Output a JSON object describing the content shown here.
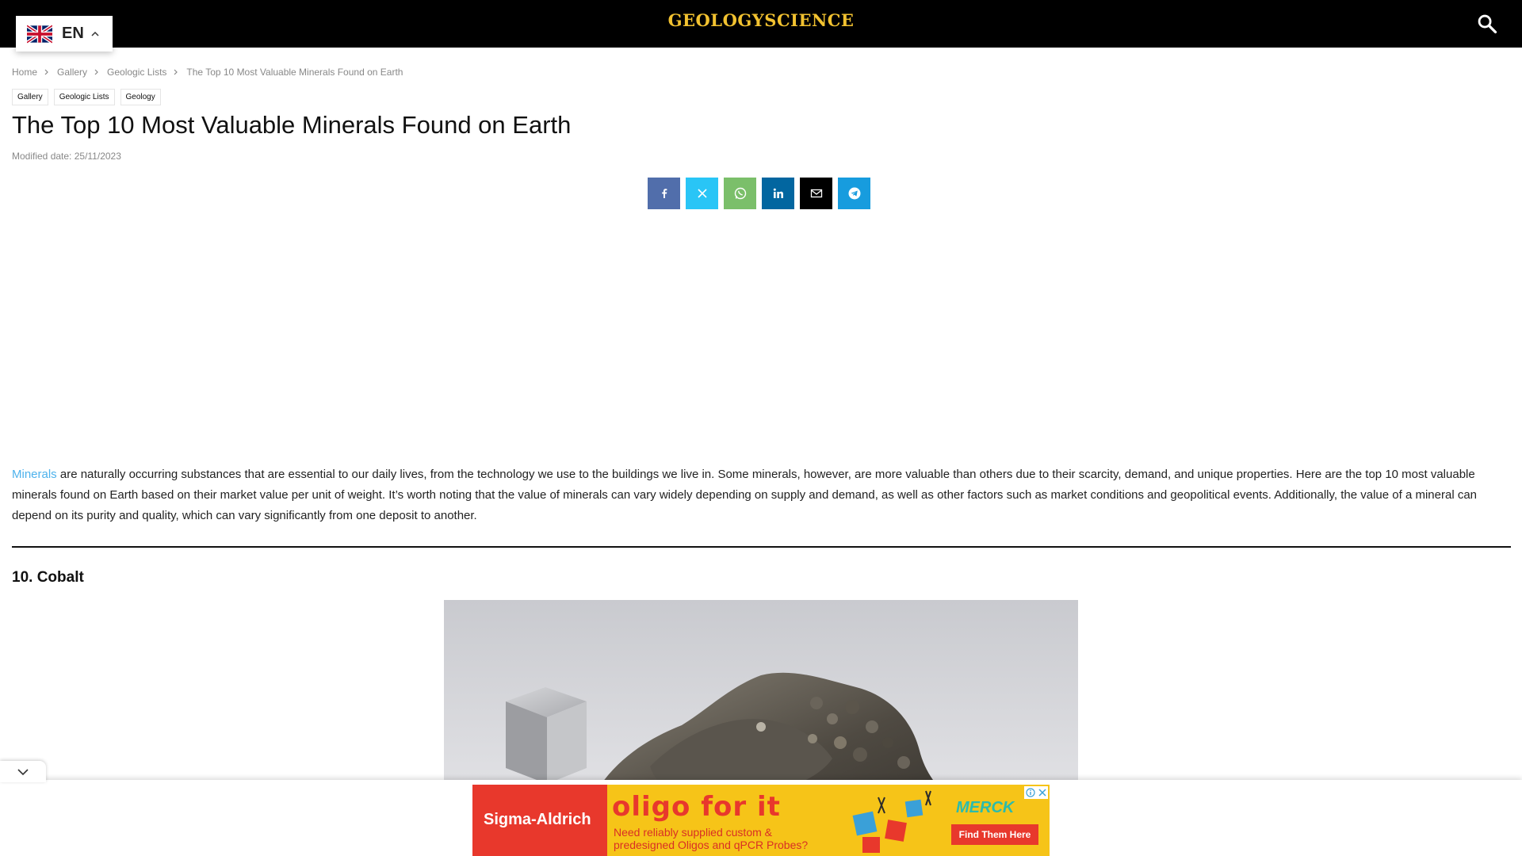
{
  "header": {
    "logo_text": "GEOLOGYSCIENCE",
    "logo_color": "#f2c230",
    "background": "#000000"
  },
  "language": {
    "code": "EN",
    "flag": "uk-flag-icon"
  },
  "breadcrumb": {
    "items": [
      "Home",
      "Gallery",
      "Geologic Lists",
      "The Top 10 Most Valuable Minerals Found on Earth"
    ]
  },
  "tags": [
    "Gallery",
    "Geologic Lists",
    "Geology"
  ],
  "article": {
    "title": "The Top 10 Most Valuable Minerals Found on Earth",
    "modified": "Modified date: 25/11/2023",
    "intro_link": "Minerals",
    "intro_rest": " are naturally occurring substances that are essential to our daily lives, from the technology we use to the buildings we live in. Some minerals, however, are more valuable than others due to their scarcity, demand, and unique properties. Here are the top 10 most valuable minerals found on Earth based on their market value per unit of weight. It’s worth noting that the value of minerals can vary widely depending on supply and demand, as well as other factors such as market conditions and geopolitical events. Additionally, the value of a mineral can depend on its purity and quality, which can vary significantly from one deposit to another.",
    "section_heading": "10. Cobalt"
  },
  "share": {
    "buttons": [
      {
        "name": "facebook",
        "icon": "facebook-icon",
        "color": "#516eab"
      },
      {
        "name": "twitter",
        "icon": "x-icon",
        "color": "#29c5f6"
      },
      {
        "name": "whatsapp",
        "icon": "whatsapp-icon",
        "color": "#7bbf6a"
      },
      {
        "name": "linkedin",
        "icon": "linkedin-icon",
        "color": "#0266a0"
      },
      {
        "name": "email",
        "icon": "mail-icon",
        "color": "#000000"
      },
      {
        "name": "telegram",
        "icon": "telegram-icon",
        "color": "#179cde"
      }
    ]
  },
  "ad": {
    "brand": "Sigma-Aldrich",
    "headline": "oligo for it",
    "subtext": "Need reliably supplied custom & predesigned Oligos and qPCR Probes?",
    "partner": "MERCK",
    "cta": "Find Them Here"
  },
  "colors": {
    "link": "#4db2ec",
    "meta": "#888888"
  }
}
